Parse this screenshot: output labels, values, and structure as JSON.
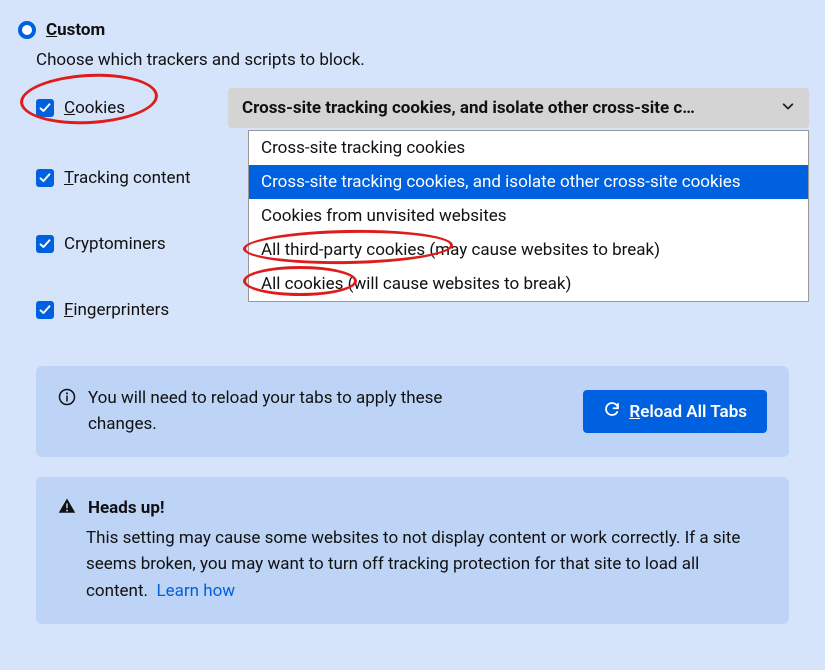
{
  "radio": {
    "label_pre": "C",
    "label_post": "ustom"
  },
  "subtitle": "Choose which trackers and scripts to block.",
  "checkboxes": {
    "cookies": {
      "pre": "C",
      "post": "ookies"
    },
    "tracking": {
      "pre": "T",
      "post": "racking content"
    },
    "crypto": {
      "label": "Cryptominers"
    },
    "finger": {
      "pre": "F",
      "post": "ingerprinters"
    }
  },
  "select": {
    "display": "Cross-site tracking cookies, and isolate other cross-site c…",
    "options": [
      "Cross-site tracking cookies",
      "Cross-site tracking cookies, and isolate other cross-site cookies",
      "Cookies from unvisited websites",
      "All third-party cookies (may cause websites to break)",
      "All cookies (will cause websites to break)"
    ],
    "selected_index": 1
  },
  "info_banner": {
    "text": "You will need to reload your tabs to apply these changes.",
    "button_pre": "R",
    "button_post": "eload All Tabs"
  },
  "warning": {
    "title": "Heads up!",
    "body": "This setting may cause some websites to not display content or work correctly. If a site seems broken, you may want to turn off tracking protection for that site to load all content.",
    "link": "Learn how"
  }
}
